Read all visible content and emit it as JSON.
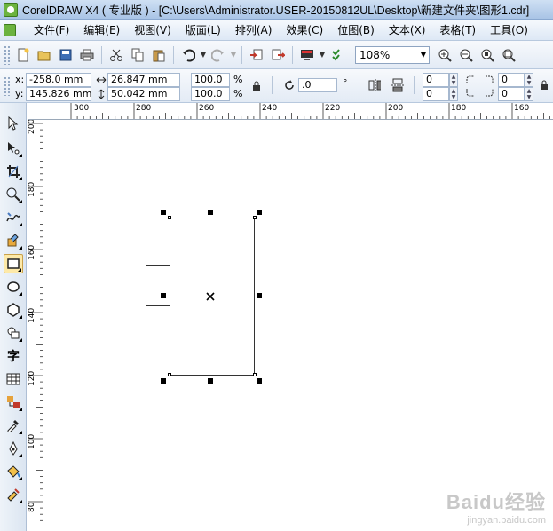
{
  "window": {
    "title": "CorelDRAW X4 ( 专业版 ) - [C:\\Users\\Administrator.USER-20150812UL\\Desktop\\新建文件夹\\图形1.cdr]"
  },
  "menu": {
    "items": [
      {
        "label": "文件(F)"
      },
      {
        "label": "编辑(E)"
      },
      {
        "label": "视图(V)"
      },
      {
        "label": "版面(L)"
      },
      {
        "label": "排列(A)"
      },
      {
        "label": "效果(C)"
      },
      {
        "label": "位图(B)"
      },
      {
        "label": "文本(X)"
      },
      {
        "label": "表格(T)"
      },
      {
        "label": "工具(O)"
      }
    ]
  },
  "toolbar": {
    "zoom_value": "108%",
    "icons": [
      "new-icon",
      "open-icon",
      "save-icon",
      "print-icon",
      "cut-icon",
      "copy-icon",
      "paste-icon",
      "undo-icon",
      "redo-icon",
      "import-icon",
      "export-icon",
      "application-launcher-icon",
      "welcome-screen-icon",
      "zoom-in-icon",
      "zoom-out-icon",
      "zoom-selected-icon",
      "zoom-page-icon"
    ]
  },
  "properties": {
    "x_label": "x:",
    "x_value": "-258.0 mm",
    "y_label": "y:",
    "y_value": "145.826 mm",
    "width_value": "26.847 mm",
    "height_value": "50.042 mm",
    "scale_x": "100.0",
    "scale_y": "100.0",
    "percent": "%",
    "rotation_value": ".0",
    "degree": "°",
    "corner_tl": "0",
    "corner_bl": "0",
    "corner_tr": "0",
    "corner_br": "0"
  },
  "ruler": {
    "h_labels": [
      "300",
      "280",
      "260",
      "240",
      "220",
      "200",
      "180",
      "160"
    ],
    "v_labels": [
      "200",
      "180",
      "160",
      "140",
      "120",
      "100",
      "80"
    ]
  },
  "watermark": {
    "brand": "Baidu经验",
    "url": "jingyan.baidu.com"
  },
  "colors": {
    "titlebar": "#a9c4e6",
    "selection_handle": "#000000",
    "active_tool": "#fde9a8"
  }
}
